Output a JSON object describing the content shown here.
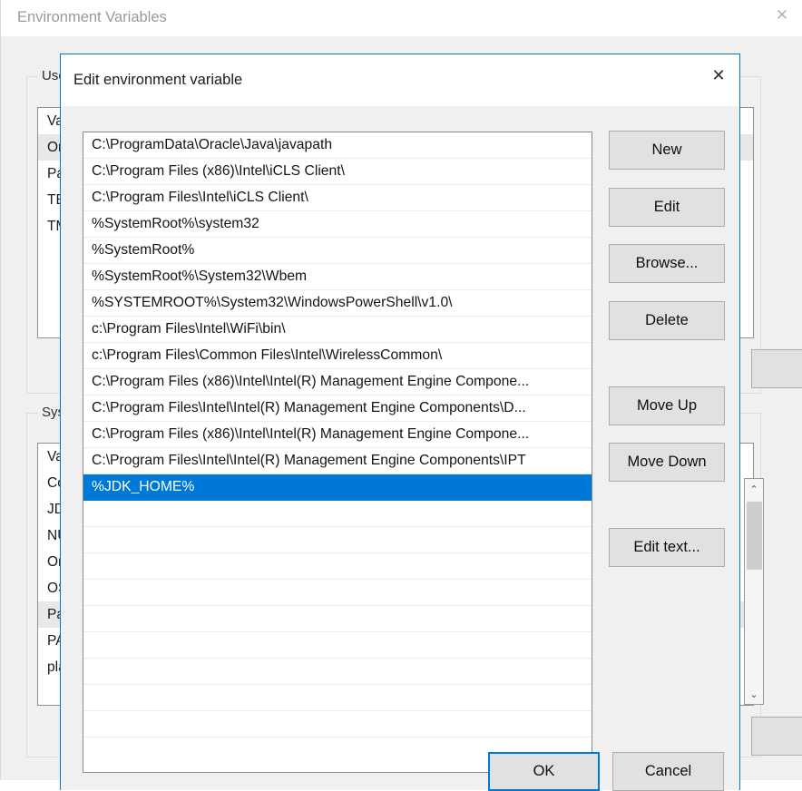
{
  "parent_window": {
    "title": "Environment Variables",
    "close_icon": "close-icon",
    "close_glyph": "✕",
    "user_group": {
      "label": "User",
      "rows": [
        "Va",
        "On",
        "Pat",
        "TE",
        "TM"
      ],
      "selected_index": 1
    },
    "system_group": {
      "label": "Syste",
      "rows": [
        "Va",
        "Co",
        "JD",
        "NU",
        "On",
        "OS",
        "Pat",
        "PA",
        "pla"
      ],
      "selected_index": 6
    },
    "scrollbar": {
      "up_glyph": "⌃",
      "down_glyph": "⌄"
    }
  },
  "dialog": {
    "title": "Edit environment variable",
    "close_icon": "close-icon",
    "close_glyph": "✕",
    "path_list": {
      "entries": [
        "C:\\ProgramData\\Oracle\\Java\\javapath",
        "C:\\Program Files (x86)\\Intel\\iCLS Client\\",
        "C:\\Program Files\\Intel\\iCLS Client\\",
        "%SystemRoot%\\system32",
        "%SystemRoot%",
        "%SystemRoot%\\System32\\Wbem",
        "%SYSTEMROOT%\\System32\\WindowsPowerShell\\v1.0\\",
        "c:\\Program Files\\Intel\\WiFi\\bin\\",
        "c:\\Program Files\\Common Files\\Intel\\WirelessCommon\\",
        "C:\\Program Files (x86)\\Intel\\Intel(R) Management Engine Compone...",
        "C:\\Program Files\\Intel\\Intel(R) Management Engine Components\\D...",
        "C:\\Program Files (x86)\\Intel\\Intel(R) Management Engine Compone...",
        "C:\\Program Files\\Intel\\Intel(R) Management Engine Components\\IPT",
        "%JDK_HOME%"
      ],
      "selected_index": 13,
      "empty_row_count": 9
    },
    "buttons": {
      "new": "New",
      "edit": "Edit",
      "browse": "Browse...",
      "delete": "Delete",
      "move_up": "Move Up",
      "move_down": "Move Down",
      "edit_text": "Edit text...",
      "ok": "OK",
      "cancel": "Cancel"
    }
  },
  "colors": {
    "accent": "#0078d7",
    "dialog_bg": "#f0f0f0",
    "button_bg": "#e1e1e1",
    "button_border": "#adadad",
    "list_bg": "#ffffff",
    "selection_bg": "#0078d7",
    "selection_text": "#ffffff",
    "title_text_inactive": "#9a9a9a"
  }
}
